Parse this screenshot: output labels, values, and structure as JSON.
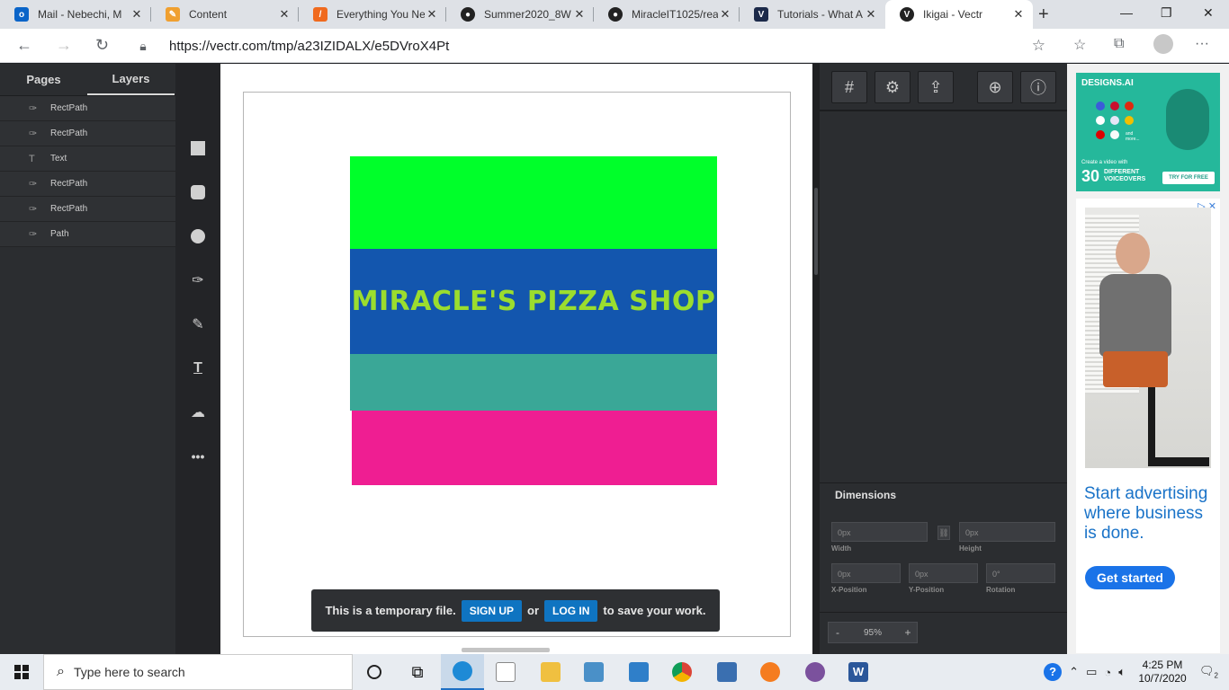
{
  "browser": {
    "tabs": [
      {
        "title": "Mail - Nebechi, M",
        "fav_text": "o",
        "fav_color": "#0a64c8"
      },
      {
        "title": "Content",
        "fav_text": "✎",
        "fav_color": "#f0a030"
      },
      {
        "title": "Everything You Ne",
        "fav_text": "/",
        "fav_color": "#f06a1e"
      },
      {
        "title": "Summer2020_8W",
        "fav_text": "●",
        "fav_color": "#222222"
      },
      {
        "title": "MiracleIT1025/rea",
        "fav_text": "●",
        "fav_color": "#222222"
      },
      {
        "title": "Tutorials - What A",
        "fav_text": "V",
        "fav_color": "#1c2a4a"
      },
      {
        "title": "Ikigai - Vectr",
        "fav_text": "V",
        "fav_color": "#222222"
      }
    ],
    "url": "https://vectr.com/tmp/a23IZIDALX/e5DVroX4Pt"
  },
  "left_panel": {
    "tabs": [
      "Pages",
      "Layers"
    ],
    "active_tab": "Layers",
    "layers": [
      {
        "name": "RectPath",
        "icon": "pen-icon"
      },
      {
        "name": "RectPath",
        "icon": "pen-icon"
      },
      {
        "name": "Text",
        "icon": "text-icon"
      },
      {
        "name": "RectPath",
        "icon": "pen-icon"
      },
      {
        "name": "RectPath",
        "icon": "pen-icon"
      },
      {
        "name": "Path",
        "icon": "pen-icon"
      }
    ]
  },
  "canvas": {
    "headline": "MIRACLE'S PIZZA SHOP",
    "colors": {
      "green": "#00ff2a",
      "blue": "#1356ae",
      "teal": "#3aa797",
      "pink": "#ef1e92",
      "headline": "#9bdd2e"
    },
    "temp_notice": {
      "prefix": "This is a temporary file.",
      "signup": "SIGN UP",
      "or": "or",
      "login": "LOG IN",
      "suffix": "to save your work."
    }
  },
  "properties": {
    "dimensions_title": "Dimensions",
    "width_value": "0px",
    "height_value": "0px",
    "x_value": "0px",
    "y_value": "0px",
    "rotation_value": "0°",
    "width_label": "Width",
    "height_label": "Height",
    "x_label": "X-Position",
    "y_label": "Y-Position",
    "rotation_label": "Rotation",
    "zoom_minus": "-",
    "zoom": "95%",
    "zoom_plus": "+"
  },
  "ads": {
    "ad1": {
      "brand": "DESIGNS.AI",
      "small_text": "Create a video with",
      "big_number": "30",
      "line1": "DIFFERENT",
      "line2": "VOICEOVERS",
      "more": "and more...",
      "button": "TRY FOR FREE"
    },
    "ad2": {
      "text": "Start advertising where business is done.",
      "button": "Get started"
    }
  },
  "taskbar": {
    "search_placeholder": "Type here to search",
    "time": "4:25 PM",
    "date": "10/7/2020",
    "notifications": "2"
  }
}
